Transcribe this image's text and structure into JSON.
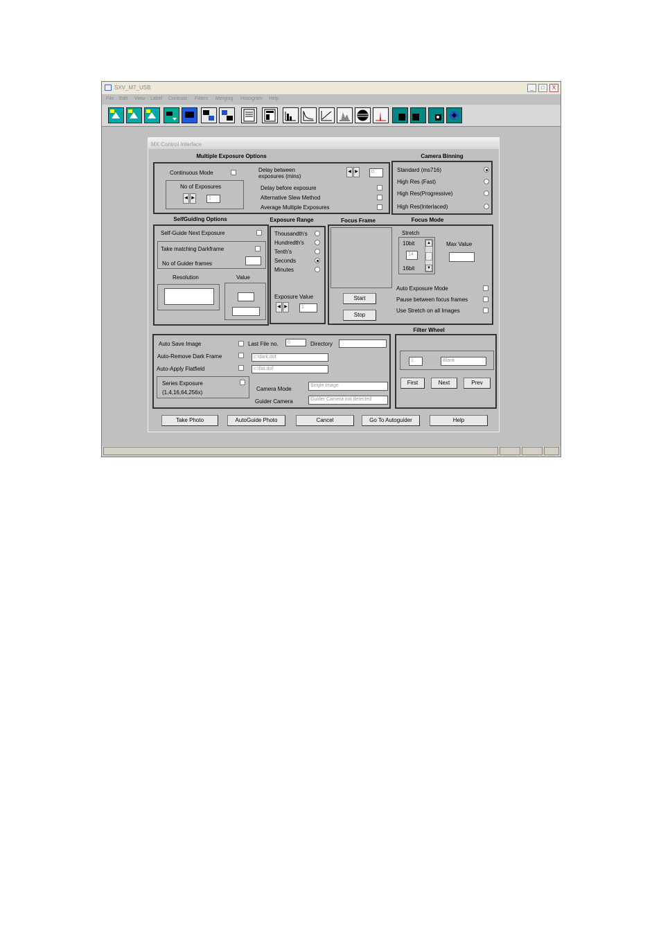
{
  "window": {
    "title": "SXV_M7_USB",
    "min_label": "_",
    "max_label": "□",
    "close_label": "X"
  },
  "menu": [
    "File",
    "Edit",
    "View",
    "Label",
    "Contrast",
    "Filters",
    "Merging",
    "Histogram",
    "Help"
  ],
  "toolbar_icons": [
    "camera-capture-icon",
    "camera-capture-2-icon",
    "camera-capture-3-icon",
    "transfer-icon",
    "monitor-icon",
    "copy-frame-icon",
    "paste-frame-icon",
    "document-icon",
    "grid-document-icon",
    "histogram-1-icon",
    "curve-1-icon",
    "curve-2-icon",
    "histogram-2-icon",
    "sphere-icon",
    "histogram-3-icon",
    "filter-1-icon",
    "filter-2-icon",
    "filter-3-icon",
    "diamond-icon"
  ],
  "dialog": {
    "title": "MX Control Interface",
    "multi": {
      "header": "Multiple Exposure Options",
      "continuous_mode": "Continuous Mode",
      "no_of_exposures": "No of Exposures",
      "exposures_value": "1",
      "delay_between": "Delay between\nexposures (mins)",
      "delay_value": "0",
      "delay_before": "Delay before exposure",
      "alt_slew": "Alternative Slew Method",
      "avg_multi": "Average Multiple Exposures"
    },
    "binning": {
      "header": "Camera Binning",
      "options": [
        "Standard (ms716)",
        "High Res (Fast)",
        "High Res(Progressive)",
        "High Res(Interlaced)"
      ],
      "selected_index": 0
    },
    "selfguide": {
      "header": "SelfGuiding Options",
      "self_guide_next": "Self-Guide Next Exposure",
      "take_matching_dark": "Take matching Darkframe",
      "no_guider_frames": "No of Guider frames",
      "resolution": "Resolution",
      "value": "Value"
    },
    "exposure_range": {
      "header": "Exposure Range",
      "options": [
        "Thousandth's",
        "Hundredth's",
        "Tenth's",
        "Seconds",
        "Minutes"
      ],
      "selected_index": 3,
      "exposure_value_label": "Exposure Value",
      "exposure_value": "1"
    },
    "focus_frame": {
      "header": "Focus Frame",
      "start": "Start",
      "stop": "Stop"
    },
    "focus_mode": {
      "header": "Focus Mode",
      "stretch": "Stretch",
      "bit10": "10bit",
      "bit16": "16bit",
      "stretch_value": "14",
      "max_value": "Max Value",
      "auto_exposure": "Auto Exposure Mode",
      "pause_between": "Pause between focus frames",
      "use_stretch": "Use Stretch on all Images"
    },
    "save": {
      "auto_save": "Auto Save Image",
      "last_file_no": "Last File no.",
      "last_file_value": "0",
      "directory": "Directory",
      "auto_remove_dark": "Auto-Remove Dark Frame",
      "dark_path": "c:\\dark.dof",
      "auto_apply_flat": "Auto-Apply Flatfield",
      "flat_path": "c:\\flat.dof",
      "series_exposure": "Series Exposure",
      "series_values": "(1,4,16,64,256x)",
      "camera_mode": "Camera Mode",
      "camera_mode_value": "Single Image",
      "guider_camera": "Guider Camera",
      "guider_camera_value": "Guider Camera not detected"
    },
    "filter_wheel": {
      "header": "Filter Wheel",
      "position": "1",
      "name": "Blank",
      "first": "First",
      "next": "Next",
      "prev": "Prev"
    },
    "buttons": {
      "take_photo": "Take Photo",
      "autoguide_photo": "AutoGuide Photo",
      "cancel": "Cancel",
      "go_to_autoguider": "Go To Autoguider",
      "help": "Help"
    }
  }
}
